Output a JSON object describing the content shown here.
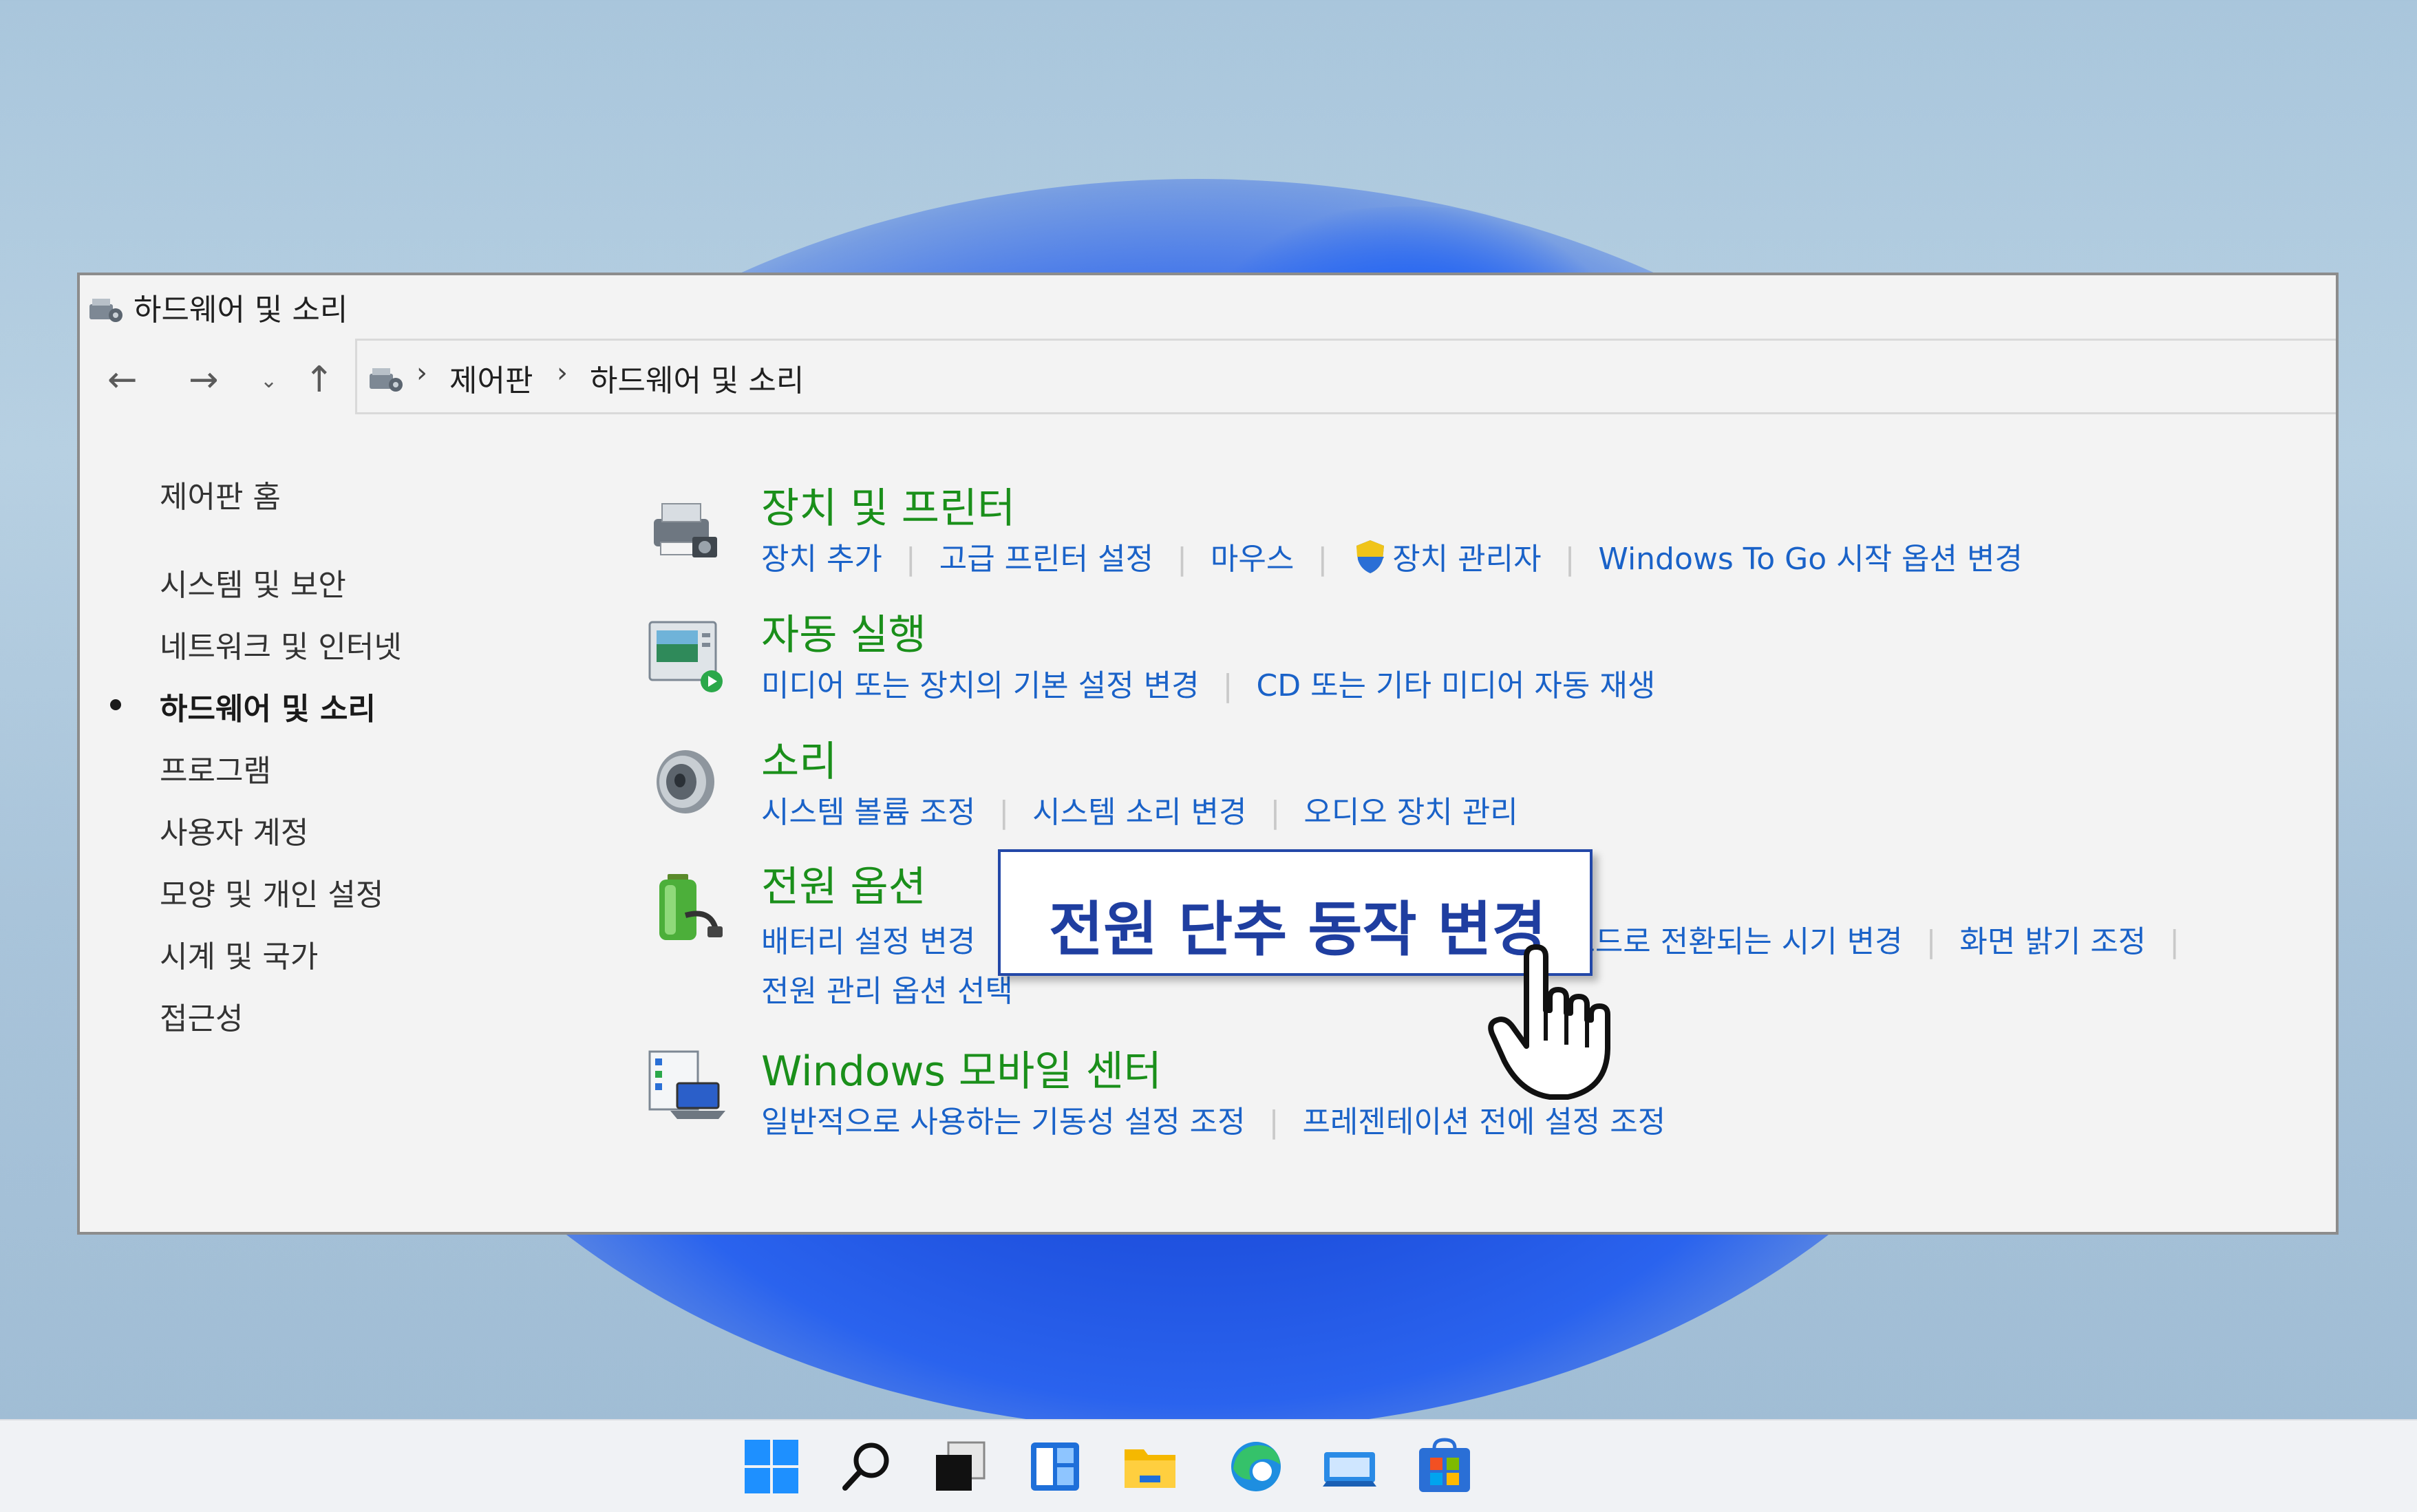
{
  "window": {
    "title": "하드웨어 및 소리"
  },
  "nav": {
    "breadcrumb": [
      "제어판",
      "하드웨어 및 소리"
    ]
  },
  "sidebar": {
    "items": [
      {
        "label": "제어판 홈"
      },
      {
        "label": "시스템 및 보안"
      },
      {
        "label": "네트워크 및 인터넷"
      },
      {
        "label": "하드웨어 및 소리",
        "active": true
      },
      {
        "label": "프로그램"
      },
      {
        "label": "사용자 계정"
      },
      {
        "label": "모양 및 개인 설정"
      },
      {
        "label": "시계 및 국가"
      },
      {
        "label": "접근성"
      }
    ]
  },
  "categories": [
    {
      "title": "장치 및 프린터",
      "icon": "printer-icon",
      "links": [
        "장치 추가",
        "고급 프린터 설정",
        "마우스",
        "장치 관리자",
        "Windows To Go 시작 옵션 변경"
      ]
    },
    {
      "title": "자동 실행",
      "icon": "autoplay-icon",
      "links": [
        "미디어 또는 장치의 기본 설정 변경",
        "CD 또는 기타 미디어 자동 재생"
      ]
    },
    {
      "title": "소리",
      "icon": "speaker-icon",
      "links": [
        "시스템 볼륨 조정",
        "시스템 소리 변경",
        "오디오 장치 관리"
      ]
    },
    {
      "title": "전원 옵션",
      "icon": "battery-icon",
      "links": [
        "배터리 설정 변경",
        "모드로 전환되는 시기 변경",
        "화면 밝기 조정",
        "전원 관리 옵션 선택"
      ]
    },
    {
      "title": "Windows 모바일 센터",
      "icon": "mobility-center-icon",
      "links": [
        "일반적으로 사용하는 기동성 설정 조정",
        "프레젠테이션 전에 설정 조정"
      ]
    }
  ],
  "callout": {
    "text": "전원 단추 동작 변경"
  },
  "taskbar": {
    "icons": [
      "windows-start-icon",
      "search-icon",
      "task-view-icon",
      "widgets-icon",
      "file-explorer-icon",
      "edge-icon",
      "mail-icon",
      "store-icon"
    ]
  },
  "colors": {
    "category_title": "#1a8f1a",
    "link": "#1a62c8",
    "callout_text": "#1f3ea0"
  }
}
